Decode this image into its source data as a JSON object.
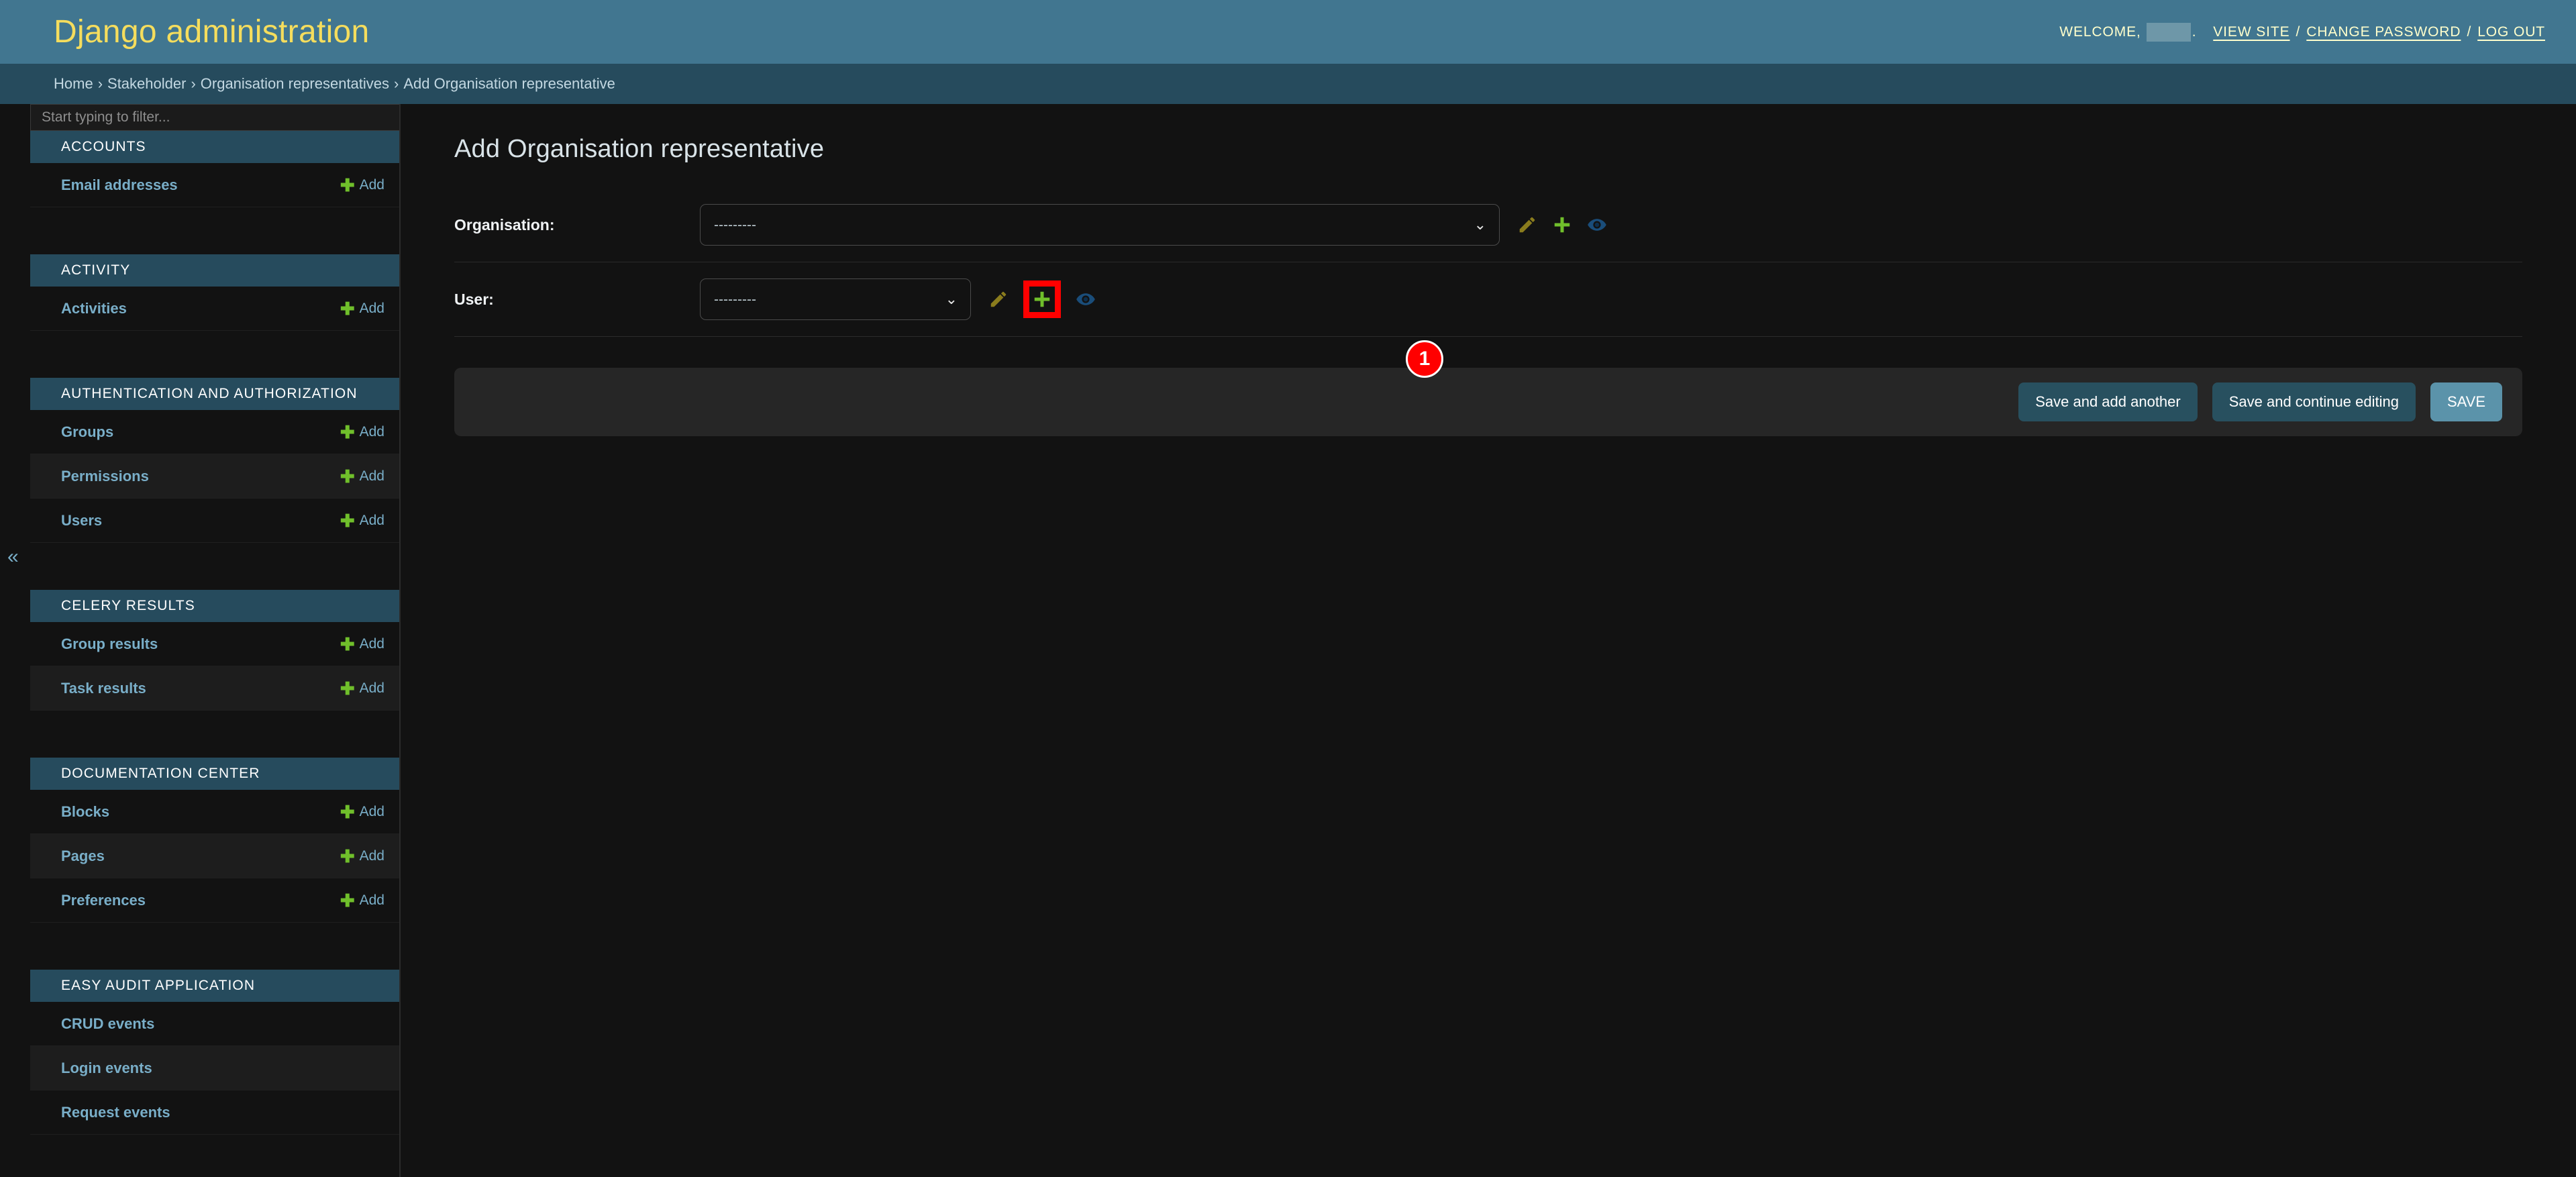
{
  "header": {
    "branding": "Django administration",
    "welcome_label": "WELCOME,",
    "username": "",
    "view_site": "VIEW SITE",
    "change_password": "CHANGE PASSWORD",
    "log_out": "LOG OUT",
    "separator": "/",
    "colors": {
      "header_bg": "#417690",
      "branding_color": "#f5dd5d",
      "breadcrumb_bg": "#264b5d"
    }
  },
  "breadcrumbs": {
    "separator": "›",
    "items": [
      "Home",
      "Stakeholder",
      "Organisation representatives",
      "Add Organisation representative"
    ]
  },
  "sidebar": {
    "filter_placeholder": "Start typing to filter...",
    "toggle_icon": "«",
    "add_label": "Add",
    "apps": [
      {
        "title": "ACCOUNTS",
        "models": [
          {
            "name": "Email addresses",
            "has_add": true
          }
        ]
      },
      {
        "title": "ACTIVITY",
        "models": [
          {
            "name": "Activities",
            "has_add": true
          }
        ]
      },
      {
        "title": "AUTHENTICATION AND AUTHORIZATION",
        "models": [
          {
            "name": "Groups",
            "has_add": true
          },
          {
            "name": "Permissions",
            "has_add": true
          },
          {
            "name": "Users",
            "has_add": true
          }
        ]
      },
      {
        "title": "CELERY RESULTS",
        "models": [
          {
            "name": "Group results",
            "has_add": true
          },
          {
            "name": "Task results",
            "has_add": true
          }
        ]
      },
      {
        "title": "DOCUMENTATION CENTER",
        "models": [
          {
            "name": "Blocks",
            "has_add": true
          },
          {
            "name": "Pages",
            "has_add": true
          },
          {
            "name": "Preferences",
            "has_add": true
          }
        ]
      },
      {
        "title": "EASY AUDIT APPLICATION",
        "models": [
          {
            "name": "CRUD events",
            "has_add": false
          },
          {
            "name": "Login events",
            "has_add": false
          },
          {
            "name": "Request events",
            "has_add": false
          }
        ]
      }
    ]
  },
  "main": {
    "page_title": "Add Organisation representative",
    "fields": [
      {
        "label": "Organisation:",
        "value": "---------",
        "options": [
          "---------"
        ],
        "widgets": [
          "change-icon",
          "add-icon",
          "view-icon"
        ]
      },
      {
        "label": "User:",
        "value": "---------",
        "options": [
          "---------"
        ],
        "widgets": [
          "change-icon",
          "add-icon",
          "view-icon"
        ]
      }
    ],
    "submit_row": {
      "save_and_add_another": "Save and add another",
      "save_and_continue": "Save and continue editing",
      "save": "SAVE"
    }
  },
  "annotation": {
    "marker_number": "1",
    "marker_color": "#ff0000",
    "target": "add-icon-for-user-field"
  }
}
